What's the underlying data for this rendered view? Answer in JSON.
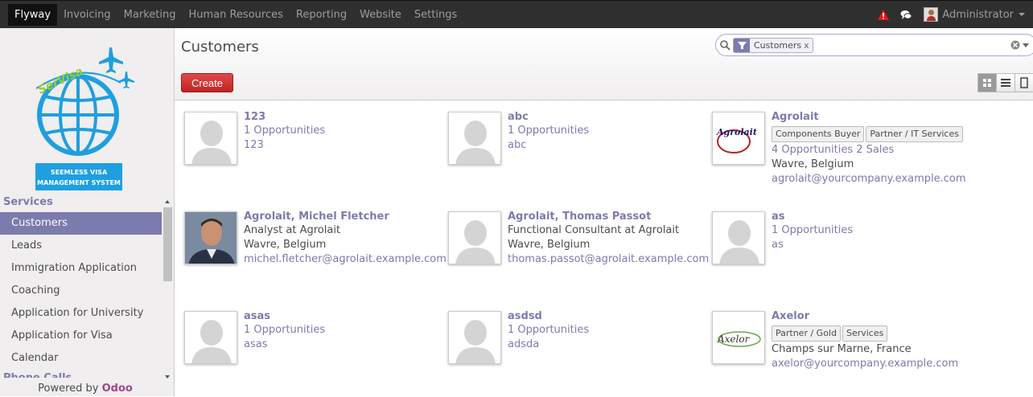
{
  "topbar": {
    "menu": [
      "Flyway",
      "Invoicing",
      "Marketing",
      "Human Resources",
      "Reporting",
      "Website",
      "Settings"
    ],
    "user_name": "Administrator"
  },
  "sidebar": {
    "logo_text": "SerVisa",
    "logo_caption_1": "SEEMLESS VISA",
    "logo_caption_2": "MANAGEMENT SYSTEM",
    "section_title": "Services",
    "items": [
      "Customers",
      "Leads",
      "Immigration Application",
      "Coaching",
      "Application for University",
      "Application for Visa",
      "Calendar"
    ],
    "next_section": "Phone Calls",
    "powered_prefix": "Powered by ",
    "powered_brand": "Odoo"
  },
  "control": {
    "title": "Customers",
    "facet_label": "Customers",
    "facet_remove": "x",
    "create_label": "Create"
  },
  "cards": [
    {
      "name": "123",
      "lines": [
        "1 Opportunities",
        "123"
      ],
      "link_lines": [
        true,
        true
      ]
    },
    {
      "name": "abc",
      "lines": [
        "1 Opportunities",
        "abc"
      ],
      "link_lines": [
        true,
        true
      ]
    },
    {
      "name": "Agrolait",
      "tags": [
        "Components Buyer",
        "Partner / IT Services"
      ],
      "lines": [
        "4 Opportunities 2 Sales",
        "Wavre, Belgium",
        "agrolait@yourcompany.example.com"
      ],
      "link_lines": [
        true,
        false,
        true
      ]
    },
    {
      "name": "Agrolait, Michel Fletcher",
      "lines": [
        "Analyst at Agrolait",
        "Wavre, Belgium",
        "michel.fletcher@agrolait.example.com"
      ],
      "link_lines": [
        false,
        false,
        true
      ]
    },
    {
      "name": "Agrolait, Thomas Passot",
      "lines": [
        "Functional Consultant at Agrolait",
        "Wavre, Belgium",
        "thomas.passot@agrolait.example.com"
      ],
      "link_lines": [
        false,
        false,
        true
      ]
    },
    {
      "name": "as",
      "lines": [
        "1 Opportunities",
        "as"
      ],
      "link_lines": [
        true,
        true
      ]
    },
    {
      "name": "asas",
      "lines": [
        "1 Opportunities",
        "asas"
      ],
      "link_lines": [
        true,
        true
      ]
    },
    {
      "name": "asdsd",
      "lines": [
        "1 Opportunities",
        "adsda"
      ],
      "link_lines": [
        true,
        true
      ]
    },
    {
      "name": "Axelor",
      "tags": [
        "Partner / Gold",
        "Services"
      ],
      "lines": [
        "Champs sur Marne, France",
        "axelor@yourcompany.example.com"
      ],
      "link_lines": [
        false,
        true
      ]
    }
  ],
  "logos": {
    "agrolait": "Agrolait",
    "axelor": "Axelor"
  },
  "colors": {
    "accent": "#7c7bad",
    "create": "#dc4141",
    "topbar": "#2f2f2f",
    "alert": "#e01b1b"
  }
}
